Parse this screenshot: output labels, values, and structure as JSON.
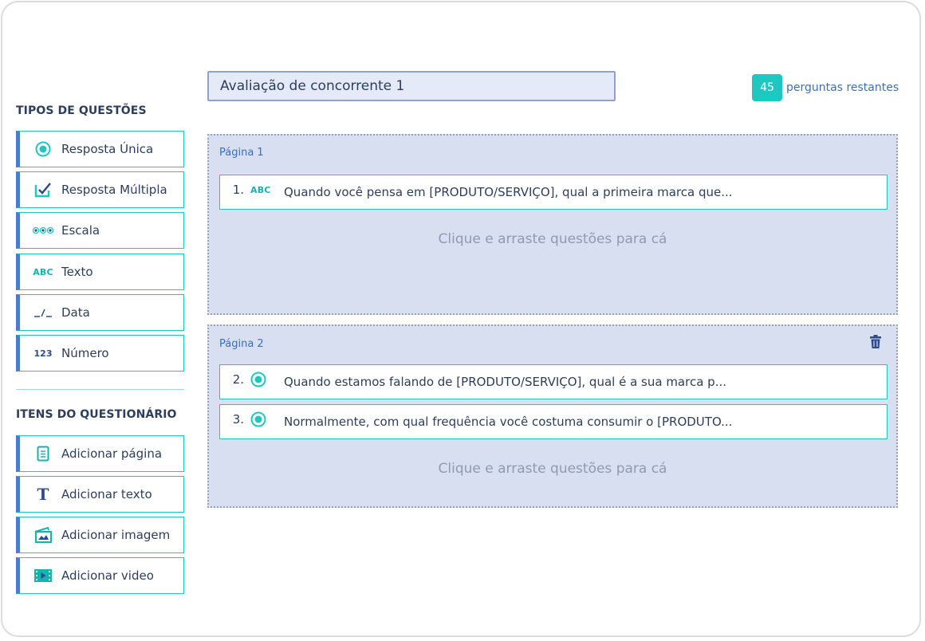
{
  "sidebar": {
    "question_types_title": "TIPOS DE QUESTÕES",
    "question_types": [
      {
        "label": "Resposta Única",
        "icon": "radio-icon"
      },
      {
        "label": "Resposta  Múltipla",
        "icon": "checkbox-icon"
      },
      {
        "label": "Escala",
        "icon": "scale-dots-icon",
        "glyph": "●●●"
      },
      {
        "label": "Texto",
        "icon": "text-abc-icon",
        "glyph": "ABC"
      },
      {
        "label": "Data",
        "icon": "date-icon",
        "glyph": "_/_"
      },
      {
        "label": "Número",
        "icon": "number-123-icon",
        "glyph": "123"
      }
    ],
    "items_title": "ITENS DO QUESTIONÁRIO",
    "items": [
      {
        "label": "Adicionar página",
        "icon": "page-icon"
      },
      {
        "label": "Adicionar texto",
        "icon": "text-t-icon",
        "glyph": "T"
      },
      {
        "label": "Adicionar imagem",
        "icon": "image-icon"
      },
      {
        "label": "Adicionar video",
        "icon": "video-icon"
      }
    ]
  },
  "header": {
    "survey_title": "Avaliação de concorrente 1",
    "remaining_count": "45",
    "remaining_label": "perguntas restantes"
  },
  "pages": [
    {
      "label": "Página 1",
      "questions": [
        {
          "number": "1.",
          "type_icon": "text-abc-icon",
          "glyph": "ABC",
          "text": "Quando você pensa em [PRODUTO/SERVIÇO], qual a primeira marca que..."
        }
      ],
      "dropzone": "Clique e arraste questões para cá"
    },
    {
      "label": "Página 2",
      "questions": [
        {
          "number": "2.",
          "type_icon": "radio-icon",
          "text": "Quando estamos falando de [PRODUTO/SERVIÇO], qual é a sua marca p..."
        },
        {
          "number": "3.",
          "type_icon": "radio-icon",
          "text": "Normalmente, com qual frequência você costuma consumir o [PRODUTO..."
        }
      ],
      "dropzone": "Clique e arraste questões para cá",
      "delete_icon": "trash-icon"
    }
  ],
  "colors": {
    "accent_teal": "#1ec8c0",
    "accent_blue": "#4a7bd0",
    "page_background": "#d7dff0",
    "text": "#2d3e5c"
  }
}
